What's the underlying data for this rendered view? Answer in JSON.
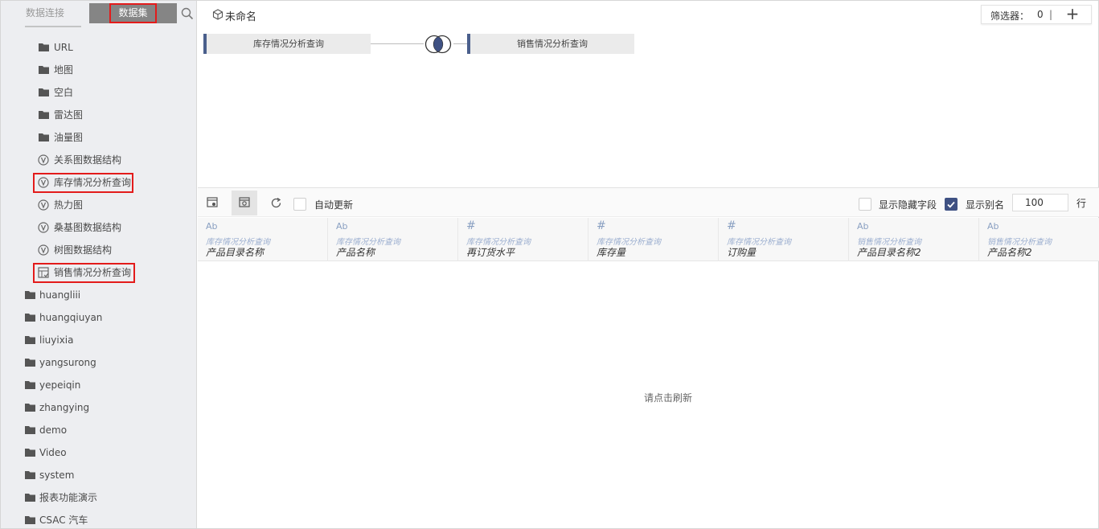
{
  "sidebar": {
    "tabs": {
      "connection": "数据连接",
      "dataset": "数据集"
    },
    "items": [
      {
        "label": "URL",
        "icon": "folder-icon"
      },
      {
        "label": "地图",
        "icon": "folder-icon"
      },
      {
        "label": "空白",
        "icon": "folder-icon"
      },
      {
        "label": "雷达图",
        "icon": "folder-icon"
      },
      {
        "label": "油量图",
        "icon": "folder-icon"
      },
      {
        "label": "关系图数据结构",
        "icon": "sql-dataset-icon"
      },
      {
        "label": "库存情况分析查询",
        "icon": "sql-dataset-icon"
      },
      {
        "label": "热力图",
        "icon": "sql-dataset-icon"
      },
      {
        "label": "桑基图数据结构",
        "icon": "sql-dataset-icon"
      },
      {
        "label": "树图数据结构",
        "icon": "sql-dataset-icon"
      },
      {
        "label": "销售情况分析查询",
        "icon": "self-service-dataset-icon"
      }
    ],
    "folders": [
      {
        "label": "huangliii"
      },
      {
        "label": "huangqiuyan"
      },
      {
        "label": "liuyixia"
      },
      {
        "label": "yangsurong"
      },
      {
        "label": "yepeiqin"
      },
      {
        "label": "zhangying"
      },
      {
        "label": "demo"
      },
      {
        "label": "Video"
      },
      {
        "label": "system"
      },
      {
        "label": "报表功能演示"
      },
      {
        "label": "CSAC 汽车"
      }
    ]
  },
  "header": {
    "title": "未命名",
    "filter_label": "筛选器：",
    "filter_count": "0",
    "filter_sep": "|",
    "filter_add": "+"
  },
  "join": {
    "left_table": "库存情况分析查询",
    "right_table": "销售情况分析查询",
    "join_type_icon": "inner-join-icon"
  },
  "preview_toolbar": {
    "auto_update": "自动更新",
    "show_hidden": "显示隐藏字段",
    "show_alias": "显示别名",
    "show_alias_checked": true,
    "rows": "100",
    "rows_unit": "行"
  },
  "columns": [
    {
      "type": "Ab",
      "source": "库存情况分析查询",
      "name": "产品目录名称"
    },
    {
      "type": "Ab",
      "source": "库存情况分析查询",
      "name": "产品名称"
    },
    {
      "type": "#",
      "source": "库存情况分析查询",
      "name": "再订货水平"
    },
    {
      "type": "#",
      "source": "库存情况分析查询",
      "name": "库存量"
    },
    {
      "type": "#",
      "source": "库存情况分析查询",
      "name": "订购量"
    },
    {
      "type": "Ab",
      "source": "销售情况分析查询",
      "name": "产品目录名称2"
    },
    {
      "type": "Ab",
      "source": "销售情况分析查询",
      "name": "产品名称2"
    }
  ],
  "preview_message": "请点击刷新",
  "colors": {
    "accent": "#4a5f8c",
    "highlight": "#e31b1b",
    "checkbox": "#3f5183"
  }
}
